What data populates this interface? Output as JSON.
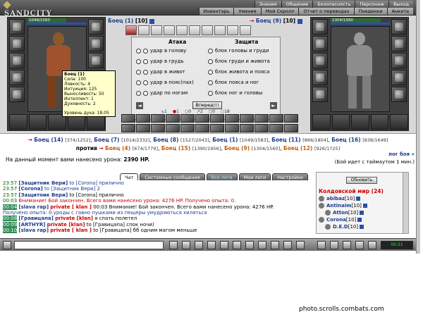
{
  "app": {
    "logo": "SANDCITY"
  },
  "menu": {
    "top": [
      "Знания",
      "Общение",
      "Безопасность",
      "Персонаж",
      "Выход"
    ],
    "sub": [
      "Инвентарь",
      "Умения",
      "Мой Скролл",
      "Отчет о переводах",
      "Поединки",
      "Анкета"
    ]
  },
  "left_fighter": {
    "name": "Боец (1)",
    "level": "[10]",
    "hp_text": "1049/1583",
    "hp_fraction": 0.66
  },
  "right_fighter": {
    "name": "Боец (9)",
    "level": "[10]",
    "hp_text": "1304/1560",
    "hp_fraction": 0.84
  },
  "tooltip": {
    "title": "Боец (1)",
    "lines": [
      "Сила: 100",
      "Ловкость: 4",
      "Интуиция: 125",
      "Выносливость: 50",
      "Интеллект: 1",
      "Духовность: 2"
    ],
    "spirit": "Уровень духа: 18.05"
  },
  "attack": {
    "header": "Атака",
    "options": [
      "удар в голову",
      "удар в грудь",
      "удар в живот",
      "удар в пояс(пах)",
      "удар по ногам"
    ]
  },
  "defense": {
    "header": "Защита",
    "options": [
      "блок головы и груди",
      "блок груди и живота",
      "блок живота и пояса",
      "блок пояса и ног",
      "блок ног и головы"
    ]
  },
  "hit_button": "Вперед!!!",
  "stats_counters": [
    "1",
    "1",
    "0",
    "2",
    "0",
    "18"
  ],
  "teams": {
    "left": [
      {
        "name": "Боец (14)",
        "hp": "[374/1252]"
      },
      {
        "name": "Боец (7)",
        "hp": "[1014/2332]"
      },
      {
        "name": "Боец (8)",
        "hp": "[1527/2043]"
      },
      {
        "name": "Боец (1)",
        "hp": "[1049/1583]"
      },
      {
        "name": "Боец (11)",
        "hp": "[866/1804]"
      },
      {
        "name": "Боец (16)",
        "hp": "[838/1649]"
      }
    ],
    "vs": "против",
    "right": [
      {
        "name": "Боец (4)",
        "hp": "[674/1779]"
      },
      {
        "name": "Боец (15)",
        "hp": "[1390/1956]"
      },
      {
        "name": "Боец (9)",
        "hp": "[1304/1560]"
      },
      {
        "name": "Боец (12)",
        "hp": "[926/1725]"
      }
    ]
  },
  "battle_log_link": "лог боя »",
  "damage_text_prefix": "На данный момент вами нанесено урона: ",
  "damage_value": "2390 HP.",
  "timeout_text": "(Бой идет с таймаутом 1 мин.)",
  "tabs": [
    "Чат",
    "Системные сообщения",
    "Все логи",
    "Мои логи",
    "Настройки"
  ],
  "chat_lines": [
    {
      "time": "23:57",
      "name": "[Защитник Вери]",
      "rest": "to [Corona] прилично"
    },
    {
      "time": "23:57",
      "name": "[Corona]",
      "rest": "to [Защитник Вери] 2"
    },
    {
      "time": "23:57",
      "name": "[Защитник Вери]",
      "rest": "to [Corona] прилично"
    },
    {
      "time": "00:03",
      "sys": "Внимание! Бой закончен. Всего вами нанесено урона: 4276 HP. Получено опыта: 0."
    },
    {
      "time": "00:04",
      "name": "[slava rap]",
      "private": "private [ klan ]",
      "rest": "00:03 Внимание! Бой закончен. Всего вами нанесено урона: 4276 HP."
    },
    {
      "plain": "Получено опыта: 0.уроды с гавно пушками из пещеры умудряються хиляться"
    },
    {
      "time": "00:08",
      "name": "[Гравицапа]",
      "private": "private [klan]",
      "rest": "я спать полетел"
    },
    {
      "time": "00:09",
      "name": "[ARTHYR]",
      "private": "private [klan]",
      "rest": "to [Гравицапа] спок ночи)"
    },
    {
      "time": "00:10",
      "name": "[slava rap]",
      "private": "private [ klan ]",
      "rest": "to [Гравицапа] бб одним магом меньше"
    }
  ],
  "players": {
    "refresh": "Обновить",
    "world": "Колдовской мир (24)",
    "list": [
      {
        "name": "abibaz",
        "level": "[10]"
      },
      {
        "name": "Antinaim",
        "level": "[10]"
      },
      {
        "name": "Atton",
        "level": "[10]"
      },
      {
        "name": "Corona",
        "level": "[10]"
      },
      {
        "name": "D.E.D",
        "level": "[10]"
      }
    ]
  },
  "clock": "00:21",
  "credit": "photo.scrolls.combats.com"
}
